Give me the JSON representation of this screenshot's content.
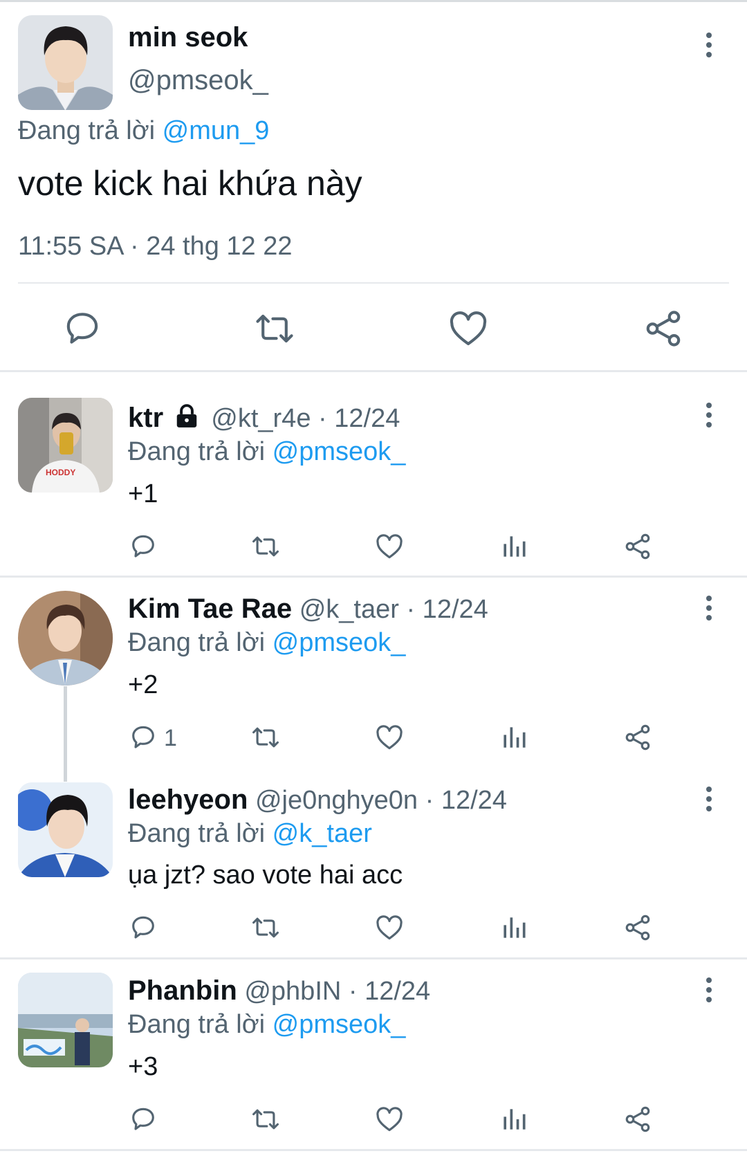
{
  "main_tweet": {
    "name": "min seok",
    "handle": "@pmseok_",
    "reply_prefix": "Đang trả lời",
    "reply_to": "@mun_9",
    "text": "vote kick hai khứa này",
    "timestamp": "11:55 SA · 24 thg 12 22"
  },
  "replies": [
    {
      "name": "ktr",
      "handle": "@kt_r4e",
      "date": "· 12/24",
      "reply_prefix": "Đang trả lời",
      "reply_to": "@pmseok_",
      "text": "+1",
      "locked": true
    },
    {
      "name": "Kim Tae Rae",
      "handle": "@k_taer",
      "date": "· 12/24",
      "reply_prefix": "Đang trả lời",
      "reply_to": "@pmseok_",
      "text": "+2",
      "reply_count": "1"
    },
    {
      "name": "leehyeon",
      "handle": "@je0nghye0n",
      "date": "· 12/24",
      "reply_prefix": "Đang trả lời",
      "reply_to": "@k_taer",
      "text": "ụa jzt? sao vote hai acc"
    },
    {
      "name": "Phanbin",
      "handle": "@phbIN",
      "date": "· 12/24",
      "reply_prefix": "Đang trả lời",
      "reply_to": "@pmseok_",
      "text": "+3"
    }
  ],
  "colors": {
    "link": "#1d9bf0",
    "secondary": "#536471",
    "text": "#0f1419",
    "divider": "#e6e9ec"
  },
  "icons": [
    "reply-icon",
    "retweet-icon",
    "like-icon",
    "views-icon",
    "share-icon",
    "more-icon",
    "lock-icon"
  ]
}
